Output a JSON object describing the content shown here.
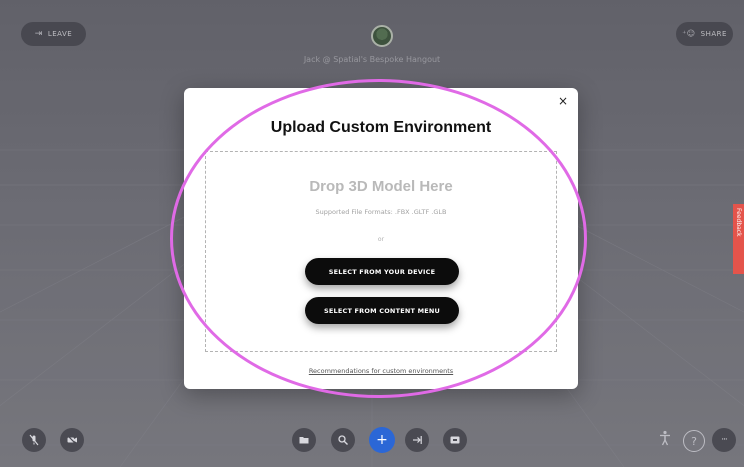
{
  "topbar": {
    "leave_label": "LEAVE",
    "share_label": "SHARE",
    "space_title": "Jack @ Spatial's Bespoke Hangout"
  },
  "modal": {
    "title": "Upload Custom Environment",
    "close_glyph": "×",
    "drop_heading": "Drop 3D Model Here",
    "formats_text": "Supported File Formats: .FBX .GLTF .GLB",
    "or_text": "or",
    "device_button": "SELECT FROM YOUR DEVICE",
    "content_button": "SELECT FROM CONTENT MENU",
    "recommend_link": "Recommendations for custom environments"
  },
  "side": {
    "feedback_label": "Feedback"
  },
  "bottombar": {
    "left": [
      "mic-muted-icon",
      "camera-off-icon"
    ],
    "center": [
      "folder-icon",
      "search-icon",
      "add-icon",
      "screen-share-icon",
      "media-icon"
    ],
    "right": [
      "accessibility-icon",
      "help-icon",
      "more-icon"
    ],
    "more_glyph": "···",
    "help_glyph": "?",
    "add_glyph": "+"
  },
  "colors": {
    "annotation": "#e06ae6",
    "primary_button": "#2b67d6",
    "feedback_tab": "#e4544b"
  }
}
